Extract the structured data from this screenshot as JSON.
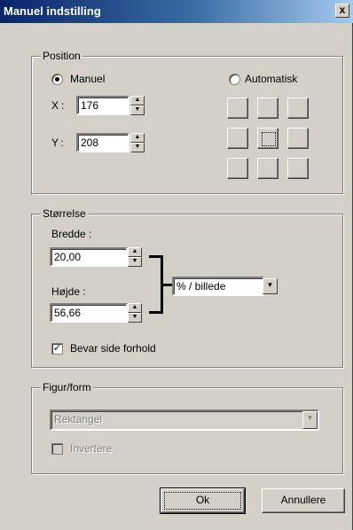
{
  "window": {
    "title": "Manuel indstilling",
    "close_glyph": "x"
  },
  "position": {
    "legend": "Position",
    "manual_label": "Manuel",
    "auto_label": "Automatisk",
    "mode": "manual",
    "x_label": "X:",
    "x_value": "176",
    "y_label": "Y:",
    "y_value": "208"
  },
  "size": {
    "legend": "Størrelse",
    "width_label": "Bredde :",
    "width_value": "20,00",
    "height_label": "Højde :",
    "height_value": "56,66",
    "unit_value": "% / billede",
    "keep_ratio_label": "Bevar side forhold",
    "keep_ratio_checked": true
  },
  "shape": {
    "legend": "Figur/form",
    "shape_value": "Rektangel",
    "invert_label": "Invertere",
    "invert_checked": false
  },
  "buttons": {
    "ok_label": "Ok",
    "cancel_label": "Annullere"
  },
  "icons": {
    "spin_up": "▲",
    "spin_down": "▼",
    "dropdown": "▼",
    "check": "✓"
  }
}
